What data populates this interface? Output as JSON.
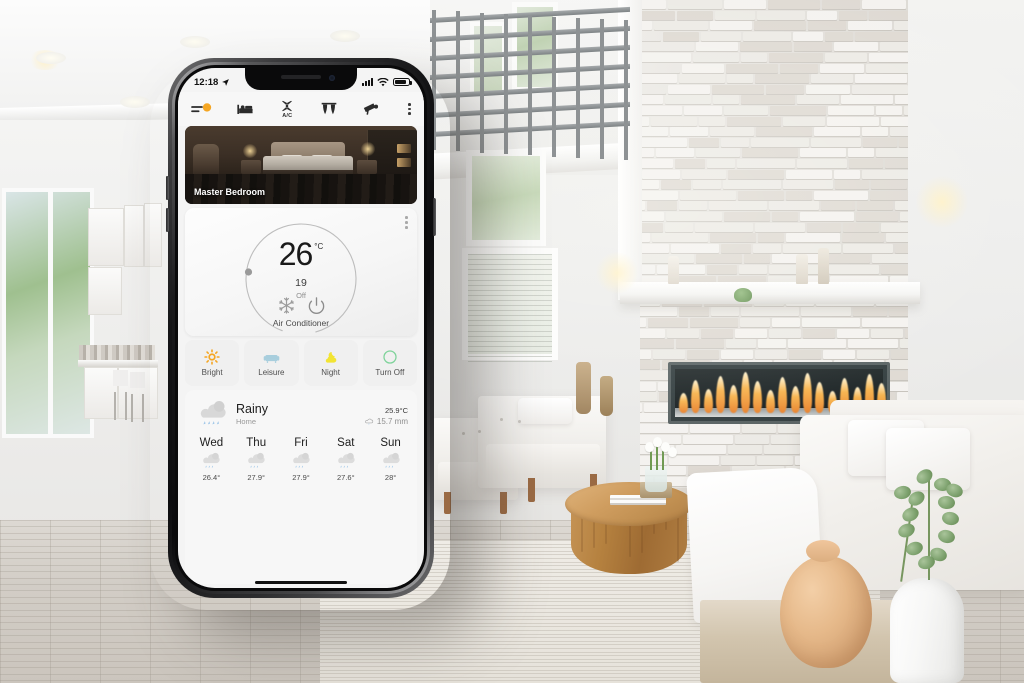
{
  "scene": {
    "description": "Modern bright living room with fireplace, white armchairs and wood coffee table"
  },
  "phone": {
    "statusbar": {
      "time": "12:18",
      "location_icon": "location-arrow-icon",
      "signal_icon": "cellular-signal-icon",
      "wifi_icon": "wifi-icon",
      "battery_icon": "battery-icon"
    },
    "toolbar": {
      "items": [
        {
          "name": "menu-lights",
          "icon": "menu-lines-icon",
          "badge": true,
          "label": ""
        },
        {
          "name": "bedroom",
          "icon": "bed-icon",
          "label": ""
        },
        {
          "name": "air-conditioner",
          "icon": "fan-icon",
          "label": "A/C"
        },
        {
          "name": "curtains",
          "icon": "curtain-icon",
          "label": ""
        },
        {
          "name": "security-camera",
          "icon": "cctv-camera-icon",
          "label": ""
        }
      ],
      "overflow_icon": "more-vertical-icon"
    },
    "room": {
      "label": "Master Bedroom"
    },
    "thermostat": {
      "temperature": "26",
      "unit": "°C",
      "setpoint": "19",
      "state": "Off",
      "device_name": "Air Conditioner",
      "mode_icon": "snowflake-icon",
      "power_icon": "power-icon",
      "overflow_icon": "more-vertical-icon",
      "dial_handle_percent": 4
    },
    "scenes": [
      {
        "label": "Bright",
        "icon": "sun-icon",
        "color": "#f5a623"
      },
      {
        "label": "Leisure",
        "icon": "sofa-icon",
        "color": "#a8cedd"
      },
      {
        "label": "Night",
        "icon": "moon-cloud-icon",
        "color": "#f2e433"
      },
      {
        "label": "Turn Off",
        "icon": "circle-icon",
        "color": "#7ed39a"
      }
    ],
    "weather": {
      "condition": "Rainy",
      "location": "Home",
      "temperature": "25.9",
      "unit": "°C",
      "rainfall": "15.7 mm",
      "rain_icon": "rain-drop-icon",
      "condition_icon": "rain-cloud-icon",
      "forecast": [
        {
          "day": "Wed",
          "icon": "rain-cloud-icon",
          "temp": "26.4°"
        },
        {
          "day": "Thu",
          "icon": "rain-cloud-icon",
          "temp": "27.9°"
        },
        {
          "day": "Fri",
          "icon": "rain-cloud-icon",
          "temp": "27.9°"
        },
        {
          "day": "Sat",
          "icon": "rain-cloud-icon",
          "temp": "27.6°"
        },
        {
          "day": "Sun",
          "icon": "rain-cloud-icon",
          "temp": "28°"
        }
      ]
    }
  }
}
